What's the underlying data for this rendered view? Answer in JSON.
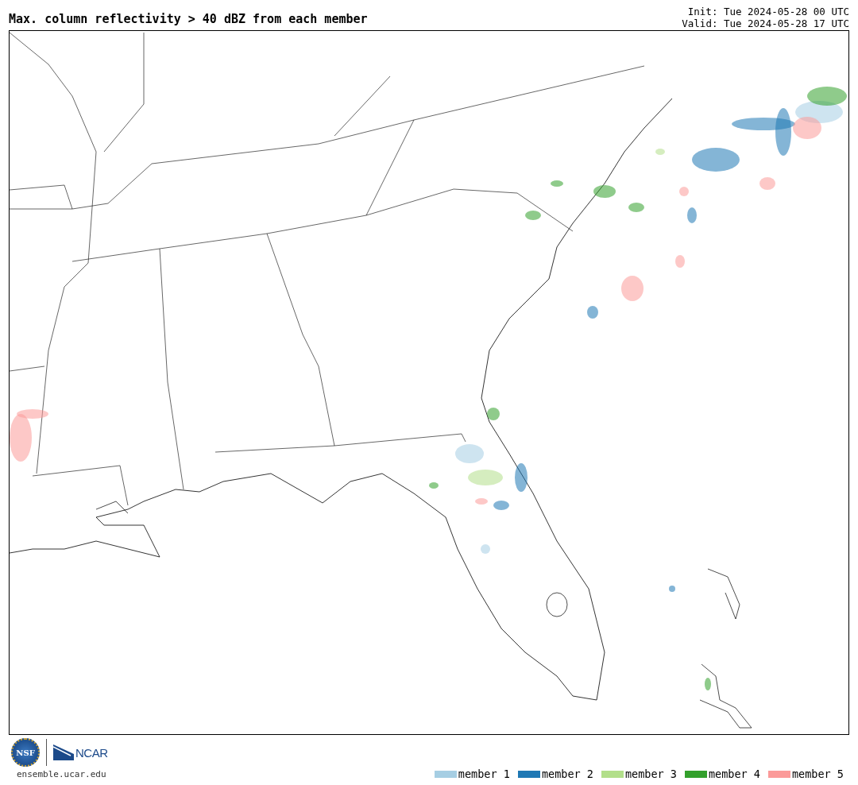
{
  "title": "Max. column reflectivity > 40 dBZ from each member",
  "init": "Init: Tue 2024-05-28 00 UTC",
  "valid": "Valid: Tue 2024-05-28 17 UTC",
  "logos": {
    "nsf": "NSF",
    "ncar": "NCAR",
    "site": "ensemble.ucar.edu"
  },
  "legend": [
    {
      "label": "member 1",
      "color": "#a6cee3"
    },
    {
      "label": "member 2",
      "color": "#1f78b4"
    },
    {
      "label": "member 3",
      "color": "#b2df8a"
    },
    {
      "label": "member 4",
      "color": "#33a02c"
    },
    {
      "label": "member 5",
      "color": "#fb9a99"
    }
  ]
}
